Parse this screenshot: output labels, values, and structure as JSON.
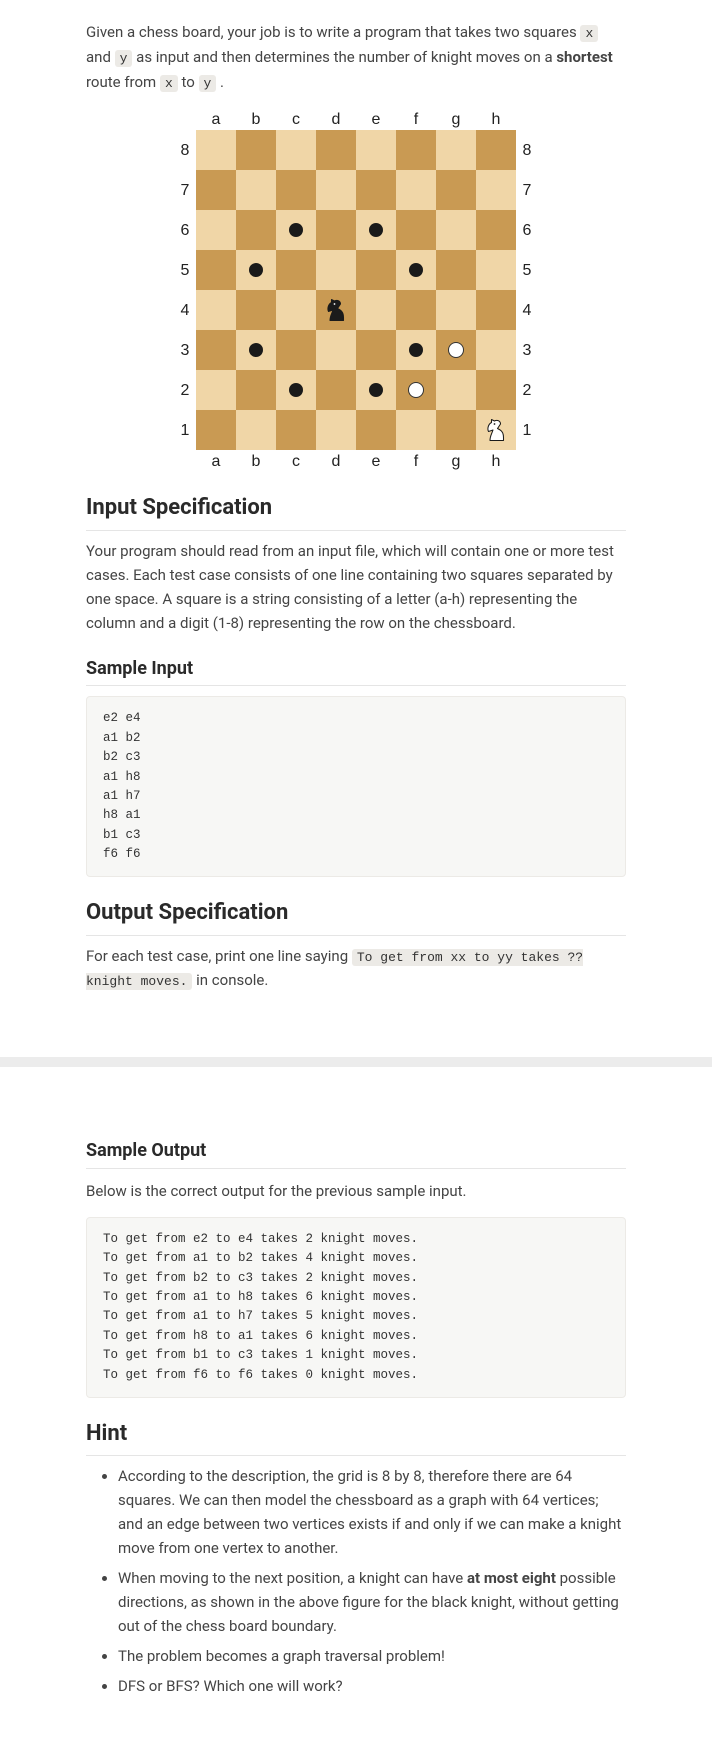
{
  "intro": {
    "pre_x": "Given a chess board, your job is to write a program that takes two squares ",
    "x": "x",
    "mid_and": " and ",
    "y": "y",
    "post_y": " as input and then determines the number of knight moves on a ",
    "shortest": "shortest",
    "route_pre": " route from ",
    "to": " to ",
    "period": " ."
  },
  "board": {
    "files": [
      "a",
      "b",
      "c",
      "d",
      "e",
      "f",
      "g",
      "h"
    ],
    "ranks": [
      "8",
      "7",
      "6",
      "5",
      "4",
      "3",
      "2",
      "1"
    ],
    "black_knight": "d4",
    "white_knight": "h1",
    "black_dots": [
      "c6",
      "e6",
      "b5",
      "f5",
      "b3",
      "f3",
      "c2",
      "e2"
    ],
    "white_dots": [
      "g3",
      "f2"
    ]
  },
  "inputSpec": {
    "heading": "Input Specification",
    "text": "Your program should read from an input file, which will contain one or more test cases. Each test case consists of one line containing two squares separated by one space. A square is a string consisting of a letter (a-h) representing the column and a digit (1-8) representing the row on the chessboard."
  },
  "sampleInput": {
    "heading": "Sample Input",
    "code": "e2 e4\na1 b2\nb2 c3\na1 h8\na1 h7\nh8 a1\nb1 c3\nf6 f6"
  },
  "outputSpec": {
    "heading": "Output Specification",
    "pre": "For each test case, print one line saying ",
    "code": "To get from xx to yy takes ?? knight moves.",
    "post": " in console."
  },
  "sampleOutput": {
    "heading": "Sample Output",
    "desc": "Below is the correct output for the previous sample input.",
    "code": "To get from e2 to e4 takes 2 knight moves.\nTo get from a1 to b2 takes 4 knight moves.\nTo get from b2 to c3 takes 2 knight moves.\nTo get from a1 to h8 takes 6 knight moves.\nTo get from a1 to h7 takes 5 knight moves.\nTo get from h8 to a1 takes 6 knight moves.\nTo get from b1 to c3 takes 1 knight moves.\nTo get from f6 to f6 takes 0 knight moves."
  },
  "hint": {
    "heading": "Hint",
    "items": [
      {
        "pre": "According to the description, the grid is 8 by 8, therefore there are 64 squares. We can then model the chessboard as a graph with 64 vertices; and an edge between two vertices exists if and only if we can make a knight move from one vertex to another.",
        "strong": "",
        "post": ""
      },
      {
        "pre": "When moving to the next position, a knight can have ",
        "strong": "at most eight",
        "post": " possible directions, as shown in the above figure for the black knight, without getting out of the chess board boundary."
      },
      {
        "pre": "The problem becomes a graph traversal problem!",
        "strong": "",
        "post": ""
      },
      {
        "pre": "DFS or BFS? Which one will work?",
        "strong": "",
        "post": ""
      }
    ]
  }
}
